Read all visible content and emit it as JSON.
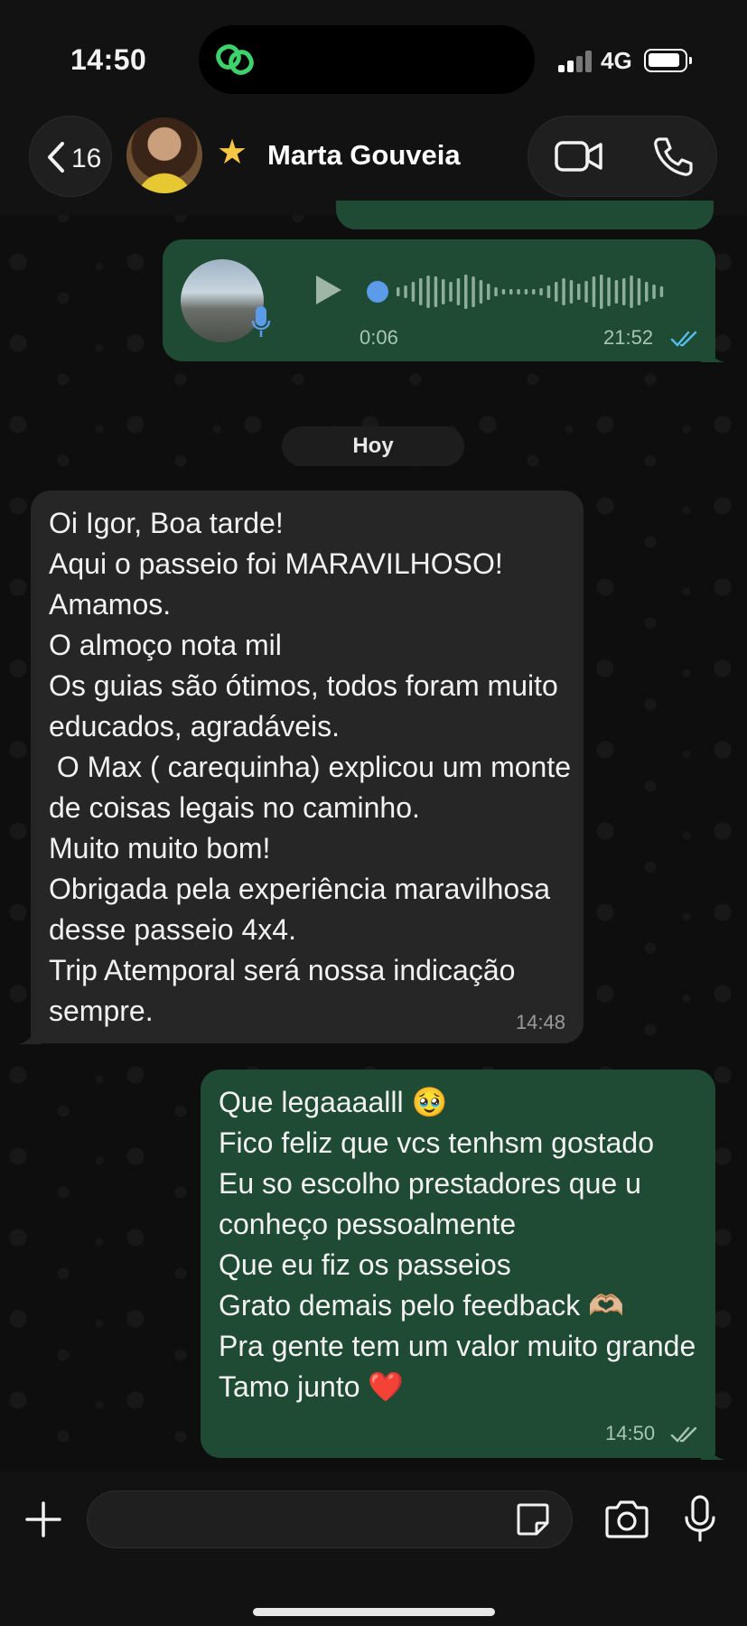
{
  "status_bar": {
    "time": "14:50",
    "network": "4G"
  },
  "header": {
    "back_count": "16",
    "contact_name": "Marta Gouveia"
  },
  "voice_message": {
    "duration": "0:06",
    "time": "21:52"
  },
  "date_divider": "Hoy",
  "incoming_message": {
    "text": "Oi Igor, Boa tarde!\nAqui o passeio foi MARAVILHOSO!\nAmamos.\nO almoço nota mil\nOs guias são ótimos, todos foram muito educados, agradáveis.\n O Max ( carequinha) explicou um monte de coisas legais no caminho.\nMuito muito bom!\nObrigada pela experiência maravilhosa desse passeio 4x4.\nTrip Atemporal será nossa indicação sempre.",
    "time": "14:48"
  },
  "outgoing_message": {
    "text": "Que legaaaalll 🥹\nFico feliz que vcs tenhsm gostado\nEu so escolho prestadores que u conheço pessoalmente\nQue eu fiz os passeios\nGrato demais pelo feedback 🫶🏼\nPra gente tem um valor muito grande\nTamo junto ❤️",
    "time": "14:50"
  },
  "composer": {
    "value": "",
    "placeholder": ""
  },
  "colors": {
    "outgoing_bubble": "#1f4a33",
    "incoming_bubble": "#262626",
    "read_ticks": "#53bdeb"
  },
  "icons": [
    "back-chevron-icon",
    "star-icon",
    "video-call-icon",
    "phone-call-icon",
    "play-icon",
    "mic-icon",
    "plus-icon",
    "sticker-icon",
    "camera-icon"
  ]
}
